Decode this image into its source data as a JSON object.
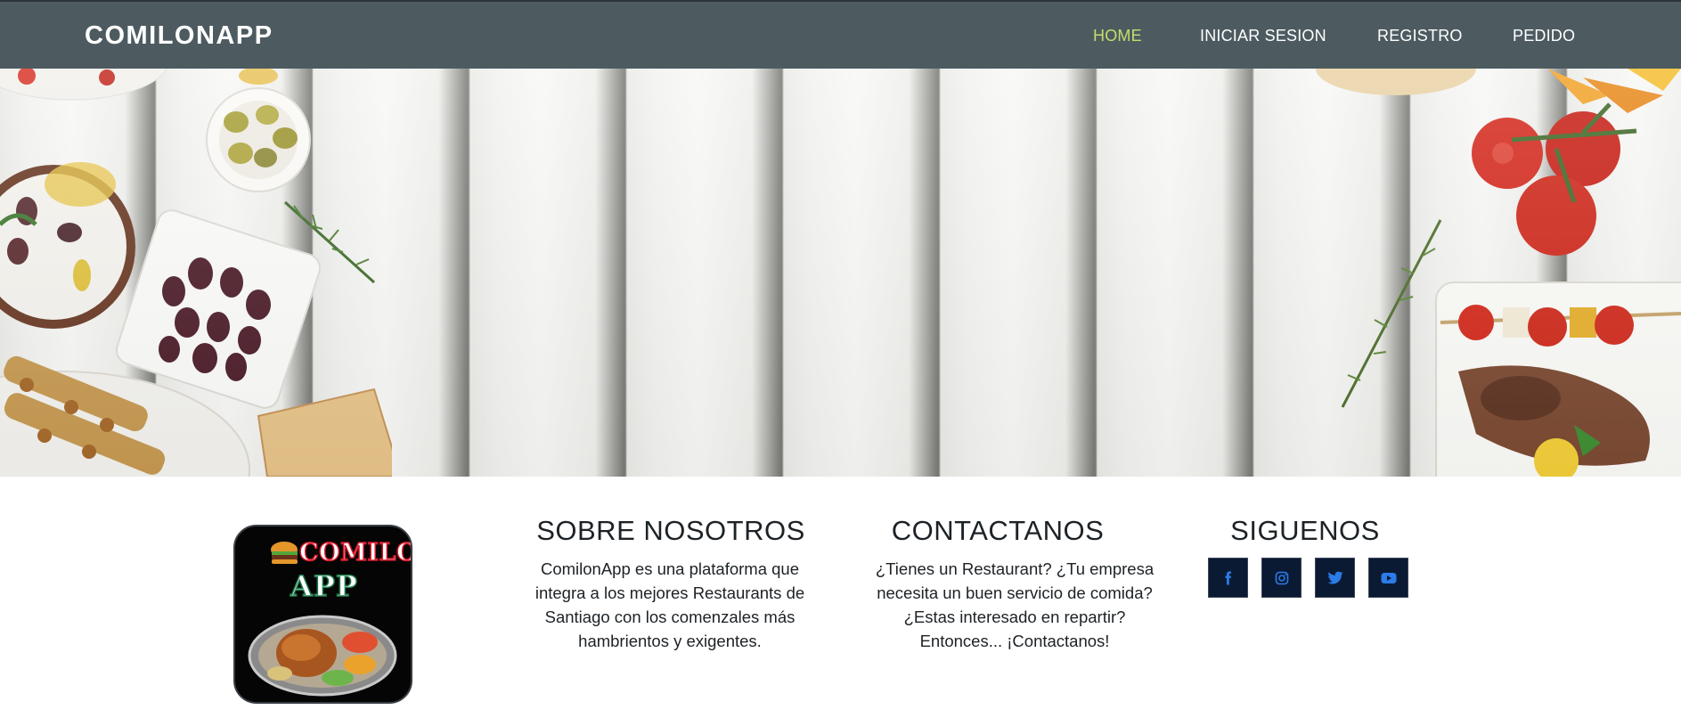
{
  "nav": {
    "brand": "COMILONAPP",
    "links": [
      {
        "label": "HOME",
        "active": true
      },
      {
        "label": "INICIAR SESION",
        "active": false
      },
      {
        "label": "REGISTRO",
        "active": false
      },
      {
        "label": "PEDIDO",
        "active": false
      }
    ]
  },
  "logo": {
    "line1": "COMILON",
    "line2": "APP"
  },
  "about": {
    "title": "SOBRE NOSOTROS",
    "text": "ComilonApp es una plataforma que integra a los mejores Restaurants de Santiago con los comenzales más hambrientos y exigentes."
  },
  "contact": {
    "title": "CONTACTANOS",
    "text": "¿Tienes un Restaurant? ¿Tu empresa necesita un buen servicio de comida? ¿Estas interesado en repartir? Entonces... ¡Contactanos!"
  },
  "follow": {
    "title": "SIGUENOS",
    "icons": [
      "facebook-icon",
      "instagram-icon",
      "twitter-icon",
      "youtube-icon"
    ]
  },
  "colors": {
    "navbar": "#4d5b61",
    "active_link": "#c6dd6b",
    "social_bg": "#0b1a33",
    "social_icon": "#2b7be8"
  }
}
